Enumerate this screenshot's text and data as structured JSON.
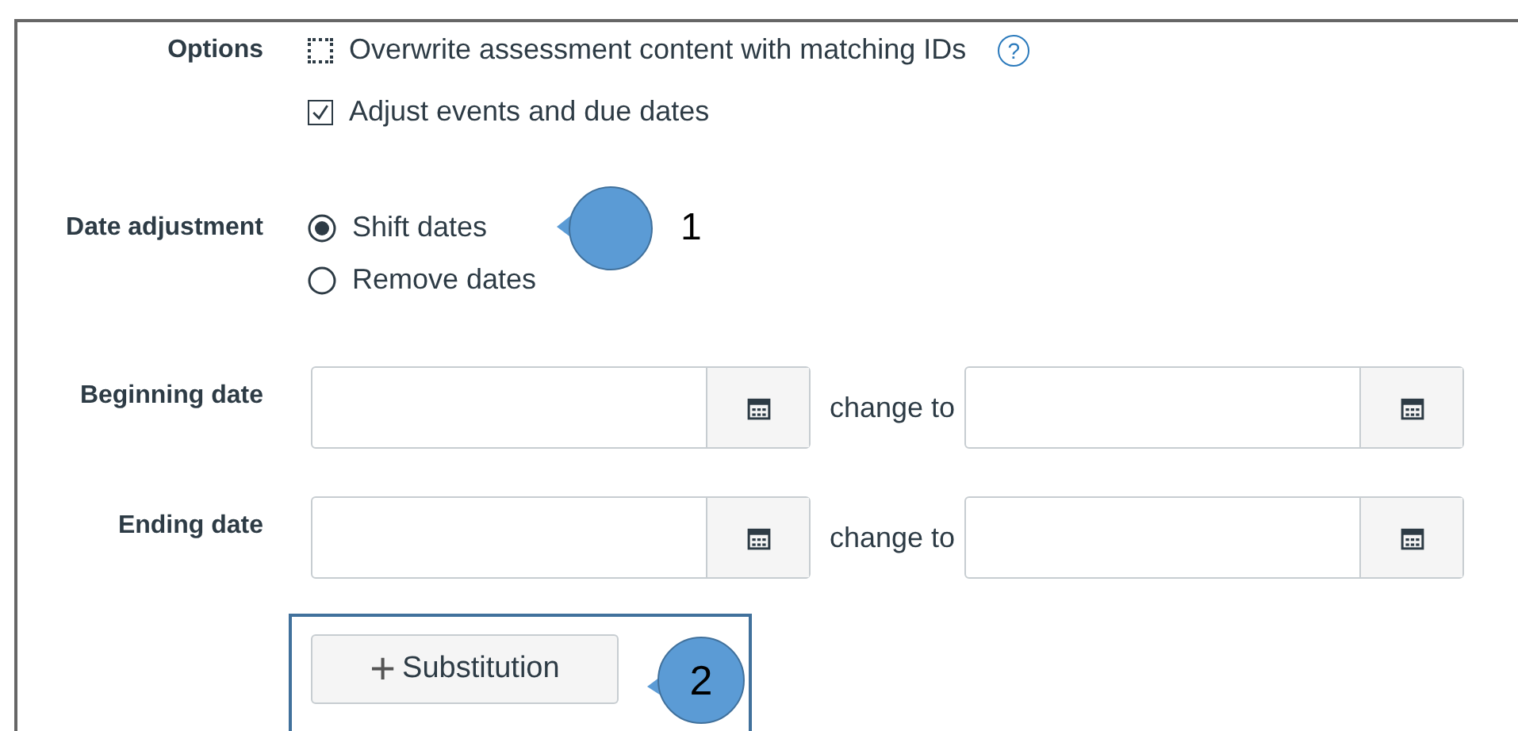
{
  "options": {
    "label": "Options",
    "items": [
      {
        "label": "Overwrite assessment content with matching IDs",
        "checked": false,
        "kind": "focused",
        "help": "?"
      },
      {
        "label": "Adjust events and due dates",
        "checked": true,
        "kind": "plain"
      }
    ]
  },
  "date_adjustment": {
    "label": "Date adjustment",
    "choices": [
      {
        "label": "Shift dates",
        "selected": true
      },
      {
        "label": "Remove dates",
        "selected": false
      }
    ]
  },
  "date_rows": [
    {
      "label": "Beginning date",
      "change_label": "change to"
    },
    {
      "label": "Ending date",
      "change_label": "change to"
    }
  ],
  "substitution_button": {
    "icon": "+",
    "label": "Substitution"
  },
  "callouts": [
    {
      "number": "1",
      "kind": "outside"
    },
    {
      "number": "2",
      "kind": "inside"
    }
  ]
}
